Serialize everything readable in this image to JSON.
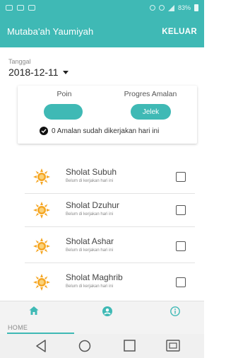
{
  "status_bar": {
    "battery_text": "83%"
  },
  "app_bar": {
    "title": "Mutaba'ah Yaumiyah",
    "action": "KELUAR"
  },
  "date": {
    "label": "Tanggal",
    "value": "2018-12-11"
  },
  "summary": {
    "poin_label": "Poin",
    "poin_value": "",
    "progres_label": "Progres Amalan",
    "progres_value": "Jelek",
    "done_text": "0 Amalan sudah dikerjakan hari ini"
  },
  "tasks": [
    {
      "name": "Sholat Subuh",
      "status": "Belum di kerjakan hari ini",
      "checked": false
    },
    {
      "name": "Sholat Dzuhur",
      "status": "Belum di kerjakan hari ini",
      "checked": false
    },
    {
      "name": "Sholat Ashar",
      "status": "Belum di kerjakan hari ini",
      "checked": false
    },
    {
      "name": "Sholat Maghrib",
      "status": "Belum di kerjakan hari ini",
      "checked": false
    }
  ],
  "bottom_nav": {
    "home_label": "HOME",
    "active": "home"
  },
  "colors": {
    "primary": "#3fb9b5",
    "sun": "#f5a623"
  },
  "icons": [
    "home-icon",
    "profile-icon",
    "info-icon",
    "back-icon",
    "home-circle-icon",
    "recents-icon",
    "sun-icon",
    "check-circle-icon"
  ]
}
